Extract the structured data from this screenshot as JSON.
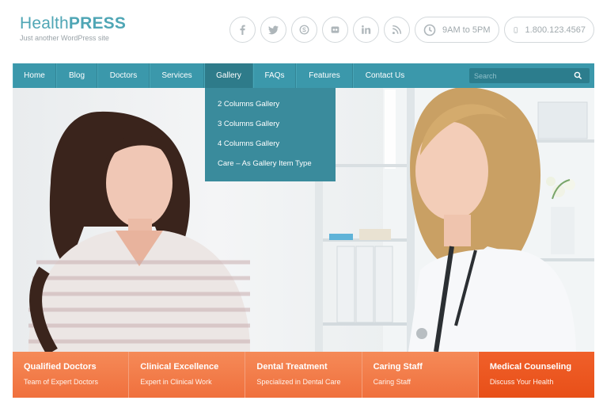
{
  "header": {
    "logo_light": "Health",
    "logo_bold": "PRESS",
    "tagline": "Just another WordPress site",
    "social": [
      {
        "icon": "facebook-icon",
        "glyph": "f"
      },
      {
        "icon": "twitter-icon",
        "glyph": "t"
      },
      {
        "icon": "skype-icon",
        "glyph": "s"
      },
      {
        "icon": "flickr-icon",
        "glyph": "fl"
      },
      {
        "icon": "linkedin-icon",
        "glyph": "in"
      },
      {
        "icon": "rss-icon",
        "glyph": "rss"
      }
    ],
    "hours": "9AM to 5PM",
    "phone": "1.800.123.4567"
  },
  "nav": {
    "items": [
      {
        "label": "Home"
      },
      {
        "label": "Blog"
      },
      {
        "label": "Doctors"
      },
      {
        "label": "Services"
      },
      {
        "label": "Gallery",
        "active": true
      },
      {
        "label": "FAQs"
      },
      {
        "label": "Features"
      },
      {
        "label": "Contact Us"
      }
    ],
    "search_placeholder": "Search"
  },
  "dropdown": {
    "items": [
      {
        "label": "2 Columns Gallery"
      },
      {
        "label": "3 Columns Gallery"
      },
      {
        "label": "4 Columns Gallery"
      },
      {
        "label": "Care – As Gallery Item Type"
      }
    ]
  },
  "features": [
    {
      "title": "Qualified Doctors",
      "subtitle": "Team of Expert Doctors"
    },
    {
      "title": "Clinical Excellence",
      "subtitle": "Expert in Clinical Work"
    },
    {
      "title": "Dental Treatment",
      "subtitle": "Specialized in Dental Care"
    },
    {
      "title": "Caring Staff",
      "subtitle": "Caring Staff"
    },
    {
      "title": "Medical Counseling",
      "subtitle": "Discuss Your Health"
    }
  ],
  "colors": {
    "brand": "#4fa6b5",
    "nav": "#3b98ab",
    "nav_active": "#2e7b8a",
    "feature_orange": "#f0703d",
    "feature_dark_orange": "#e84f18"
  }
}
